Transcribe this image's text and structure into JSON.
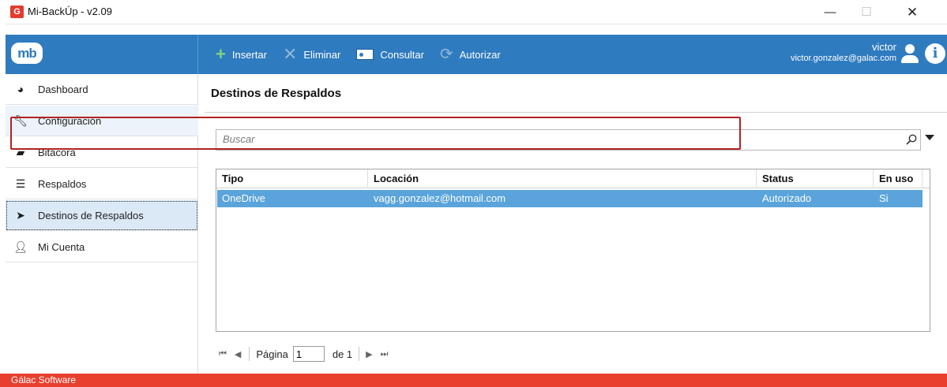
{
  "window": {
    "title": "Mi-BackÚp - v2.09",
    "app_icon_glyph": "G",
    "min_glyph": "—",
    "max_glyph": "☐",
    "close_glyph": "✕"
  },
  "topbar": {
    "logo_text": "mb",
    "toolbar": {
      "insert_label": "Insertar",
      "delete_label": "Eliminar",
      "consult_label": "Consultar",
      "authorize_label": "Autorizar"
    },
    "user": {
      "name": "victor",
      "email": "victor.gonzalez@galac.com"
    },
    "info_glyph": "i"
  },
  "sidebar": {
    "items": [
      {
        "label": "Dashboard",
        "icon": "dashboard-icon"
      },
      {
        "label": "Configuración",
        "icon": "wrench-icon"
      },
      {
        "label": "Bitácora",
        "icon": "book-icon"
      },
      {
        "label": "Respaldos",
        "icon": "database-icon"
      },
      {
        "label": "Destinos de Respaldos",
        "icon": "send-icon"
      },
      {
        "label": "Mi Cuenta",
        "icon": "user-icon"
      }
    ],
    "selected": "Destinos de Respaldos"
  },
  "main": {
    "title": "Destinos de Respaldos",
    "search": {
      "placeholder": "Buscar",
      "value": ""
    },
    "grid": {
      "columns": [
        "Tipo",
        "Locación",
        "Status",
        "En uso"
      ],
      "rows": [
        [
          "OneDrive",
          "vagg.gonzalez@hotmail.com",
          "Autorizado",
          "Si"
        ]
      ]
    },
    "pager": {
      "page_label": "Página",
      "current_page": "1",
      "of_label": "de 1"
    }
  },
  "status_bar": {
    "text": "Gálac Software"
  },
  "colors": {
    "primary": "#2f7bbf",
    "status_bar": "#e8402f",
    "selected_row": "#5aa4db",
    "highlight_box": "#b22222"
  }
}
